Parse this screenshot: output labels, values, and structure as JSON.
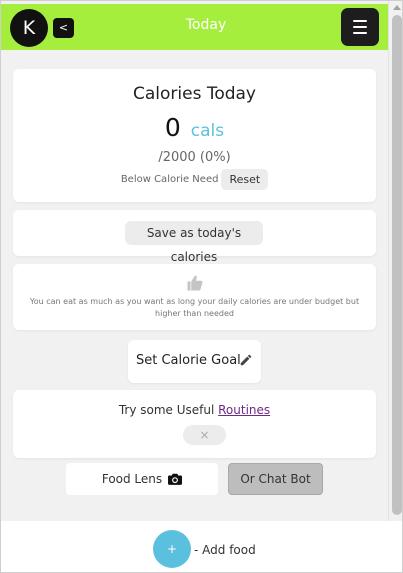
{
  "header": {
    "logo_letter": "K",
    "back_label": "<",
    "title": "Today",
    "menu_icon": "hamburger-icon",
    "accent_color": "#a6ee3d"
  },
  "calories": {
    "title": "Calories Today",
    "count": "0",
    "unit": "cals",
    "goal_text": "/2000 (0%)",
    "status": "Below Calorie Need",
    "reset_label": "Reset"
  },
  "save": {
    "label": "Save as today's calories"
  },
  "tip": {
    "icon": "thumbs-up-icon",
    "text": "You can eat as much as you want as long your daily calories are under budget but higher than needed"
  },
  "goal": {
    "label": "Set Calorie Goal",
    "icon": "pencil-icon"
  },
  "routines": {
    "prefix": "Try some Useful ",
    "link": "Routines",
    "dismiss": "×"
  },
  "actions": {
    "food_lens": "Food Lens",
    "food_lens_icon": "camera-icon",
    "chat_bot": "Or Chat Bot"
  },
  "footer": {
    "add_symbol": "+",
    "add_label": "- Add food",
    "add_color": "#5bc0de"
  }
}
